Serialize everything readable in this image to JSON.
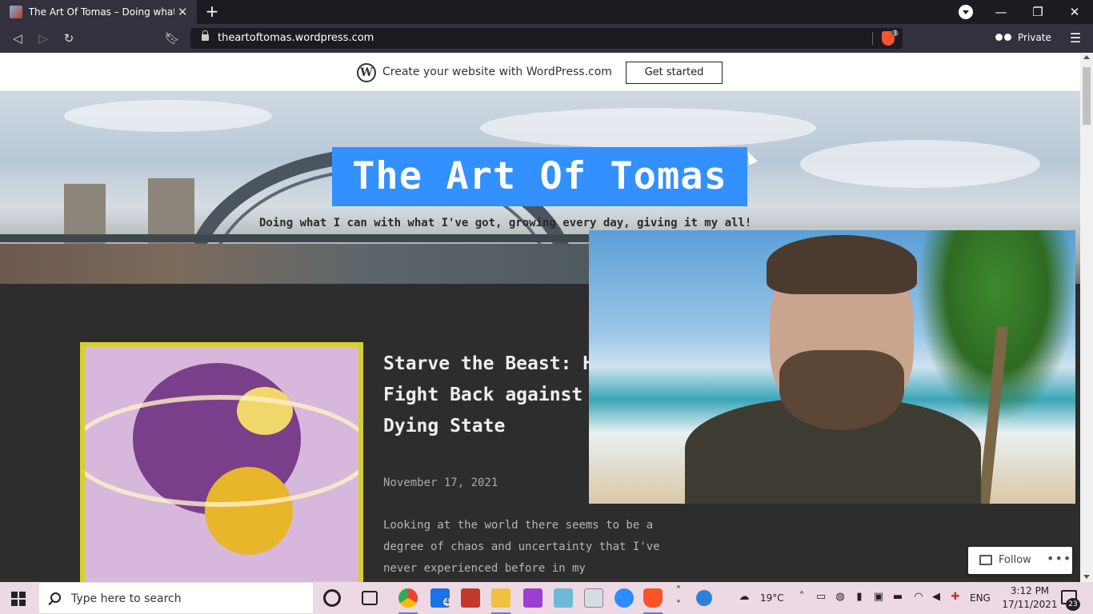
{
  "browser": {
    "tab_title": "The Art Of Tomas – Doing what I can",
    "url": "theartoftomas.wordpress.com",
    "shield_count": "3",
    "private_label": "Private"
  },
  "wp_banner": {
    "text": "Create your website with WordPress.com",
    "button_label": "Get started"
  },
  "site": {
    "title": "The Art Of Tomas",
    "tagline": "Doing what I can with what I've got, growing every day, giving it my all!"
  },
  "post": {
    "title": "Starve the Beast: How to Fight Back against the Dying State",
    "date": "November 17, 2021",
    "excerpt": "Looking at the world there seems to be a degree of chaos and uncertainty that I've never experienced before in my"
  },
  "follow": {
    "label": "Follow",
    "more": "•••"
  },
  "taskbar": {
    "search_placeholder": "Type here to search",
    "mail_badge": "4",
    "weather": "19°C",
    "language": "ENG",
    "time": "3:12 PM",
    "date": "17/11/2021",
    "notification_count": "23"
  },
  "colors": {
    "selection": "#3390ff",
    "chrome_dark": "#1c1b22",
    "chrome_tab": "#33313d",
    "taskbar": "#ecd9e4"
  }
}
